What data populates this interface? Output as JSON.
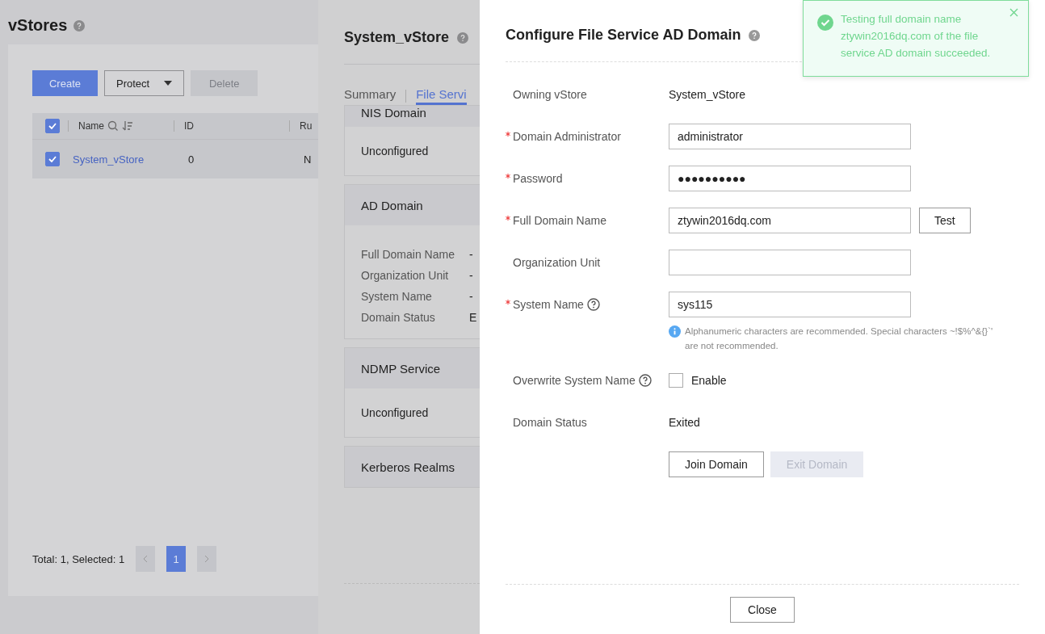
{
  "page": {
    "title": "vStores",
    "toolbar": [
      {
        "label": "Create",
        "kind": "primary",
        "disabled": false
      },
      {
        "label": "Protect",
        "kind": "dropdown",
        "disabled": false
      },
      {
        "label": "Delete",
        "kind": "plain",
        "disabled": true
      }
    ],
    "table": {
      "all_checked": true,
      "columns": [
        "Name",
        "ID",
        "Ru"
      ],
      "rows": [
        {
          "checked": true,
          "cells": [
            "System_vStore",
            "0",
            "N"
          ]
        }
      ]
    },
    "summary": "Total: 1, Selected: 1",
    "pages": [
      {
        "label": "1",
        "selected": true
      }
    ]
  },
  "detail": {
    "title": "System_vStore",
    "tabs": [
      {
        "label": "Summary",
        "selected": false
      },
      {
        "label": "File Servi",
        "selected": true
      }
    ],
    "sections": [
      {
        "title": "NIS Domain",
        "text": "Unconfigured"
      },
      {
        "title": "AD Domain",
        "fields": [
          {
            "label": "Full Domain Name",
            "value": "-"
          },
          {
            "label": "Organization Unit",
            "value": "-"
          },
          {
            "label": "System Name",
            "value": "-"
          },
          {
            "label": "Domain Status",
            "value": "E"
          }
        ]
      },
      {
        "title": "NDMP Service",
        "text": "Unconfigured"
      },
      {
        "title": "Kerberos Realms"
      }
    ]
  },
  "dialog": {
    "title": "Configure File Service AD Domain",
    "rows": [
      {
        "kind": "text",
        "label": "Owning vStore",
        "required": false,
        "help": false,
        "value": "System_vStore"
      },
      {
        "kind": "input",
        "label": "Domain Administrator",
        "required": true,
        "help": false,
        "value": "administrator"
      },
      {
        "kind": "input",
        "label": "Password",
        "required": true,
        "help": false,
        "value": "●●●●●●●●●●"
      },
      {
        "kind": "input",
        "label": "Full Domain Name",
        "required": true,
        "help": false,
        "value": "ztywin2016dq.com",
        "button": "Test"
      },
      {
        "kind": "input",
        "label": "Organization Unit",
        "required": false,
        "help": false,
        "value": ""
      },
      {
        "kind": "input",
        "label": "System Name",
        "required": true,
        "help": true,
        "value": "sys115",
        "hint": "Alphanumeric characters are recommended. Special characters ~!$%^&{}`'\nare not recommended."
      },
      {
        "kind": "checkbox",
        "label": "Overwrite System Name",
        "required": false,
        "help": true,
        "checked": false,
        "option": "Enable"
      },
      {
        "kind": "text",
        "label": "Domain Status",
        "required": false,
        "help": false,
        "value": "Exited"
      }
    ],
    "actions": [
      {
        "label": "Join Domain",
        "disabled": false
      },
      {
        "label": "Exit Domain",
        "disabled": true
      }
    ],
    "footer": "Close"
  },
  "toast": {
    "kind": "success",
    "message": "Testing full domain name ztywin2016dq.com of the file service AD domain succeeded."
  }
}
